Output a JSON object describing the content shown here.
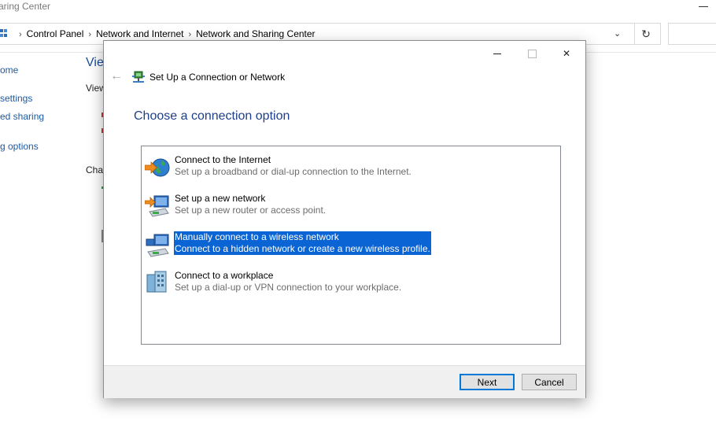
{
  "background_window": {
    "title_fragment": "aring Center",
    "breadcrumbs": [
      "Control Panel",
      "Network and Internet",
      "Network and Sharing Center"
    ],
    "refresh_glyph": "↻",
    "dropdown_glyph": "⌄",
    "sidebar_fragments": [
      "ome",
      "settings",
      "ed sharing",
      "g options"
    ],
    "heading_fragment": "Vie",
    "view_fragment": "View",
    "change_fragment": "Cha"
  },
  "dialog": {
    "title": "Set Up a Connection or Network",
    "back_glyph": "←",
    "close_glyph": "✕",
    "instruction": "Choose a connection option",
    "options": [
      {
        "title": "Connect to the Internet",
        "description": "Set up a broadband or dial-up connection to the Internet.",
        "icon": "globe-icon",
        "selected": false
      },
      {
        "title": "Set up a new network",
        "description": "Set up a new router or access point.",
        "icon": "router-icon",
        "selected": false
      },
      {
        "title": "Manually connect to a wireless network",
        "description": "Connect to a hidden network or create a new wireless profile.",
        "icon": "wireless-network-icon",
        "selected": true
      },
      {
        "title": "Connect to a workplace",
        "description": "Set up a dial-up or VPN connection to your workplace.",
        "icon": "workplace-icon",
        "selected": false
      }
    ],
    "buttons": {
      "next": "Next",
      "cancel": "Cancel"
    }
  },
  "colors": {
    "selection": "#0a64d4",
    "instruction": "#1e3f8a",
    "link": "#1a5aa6"
  }
}
